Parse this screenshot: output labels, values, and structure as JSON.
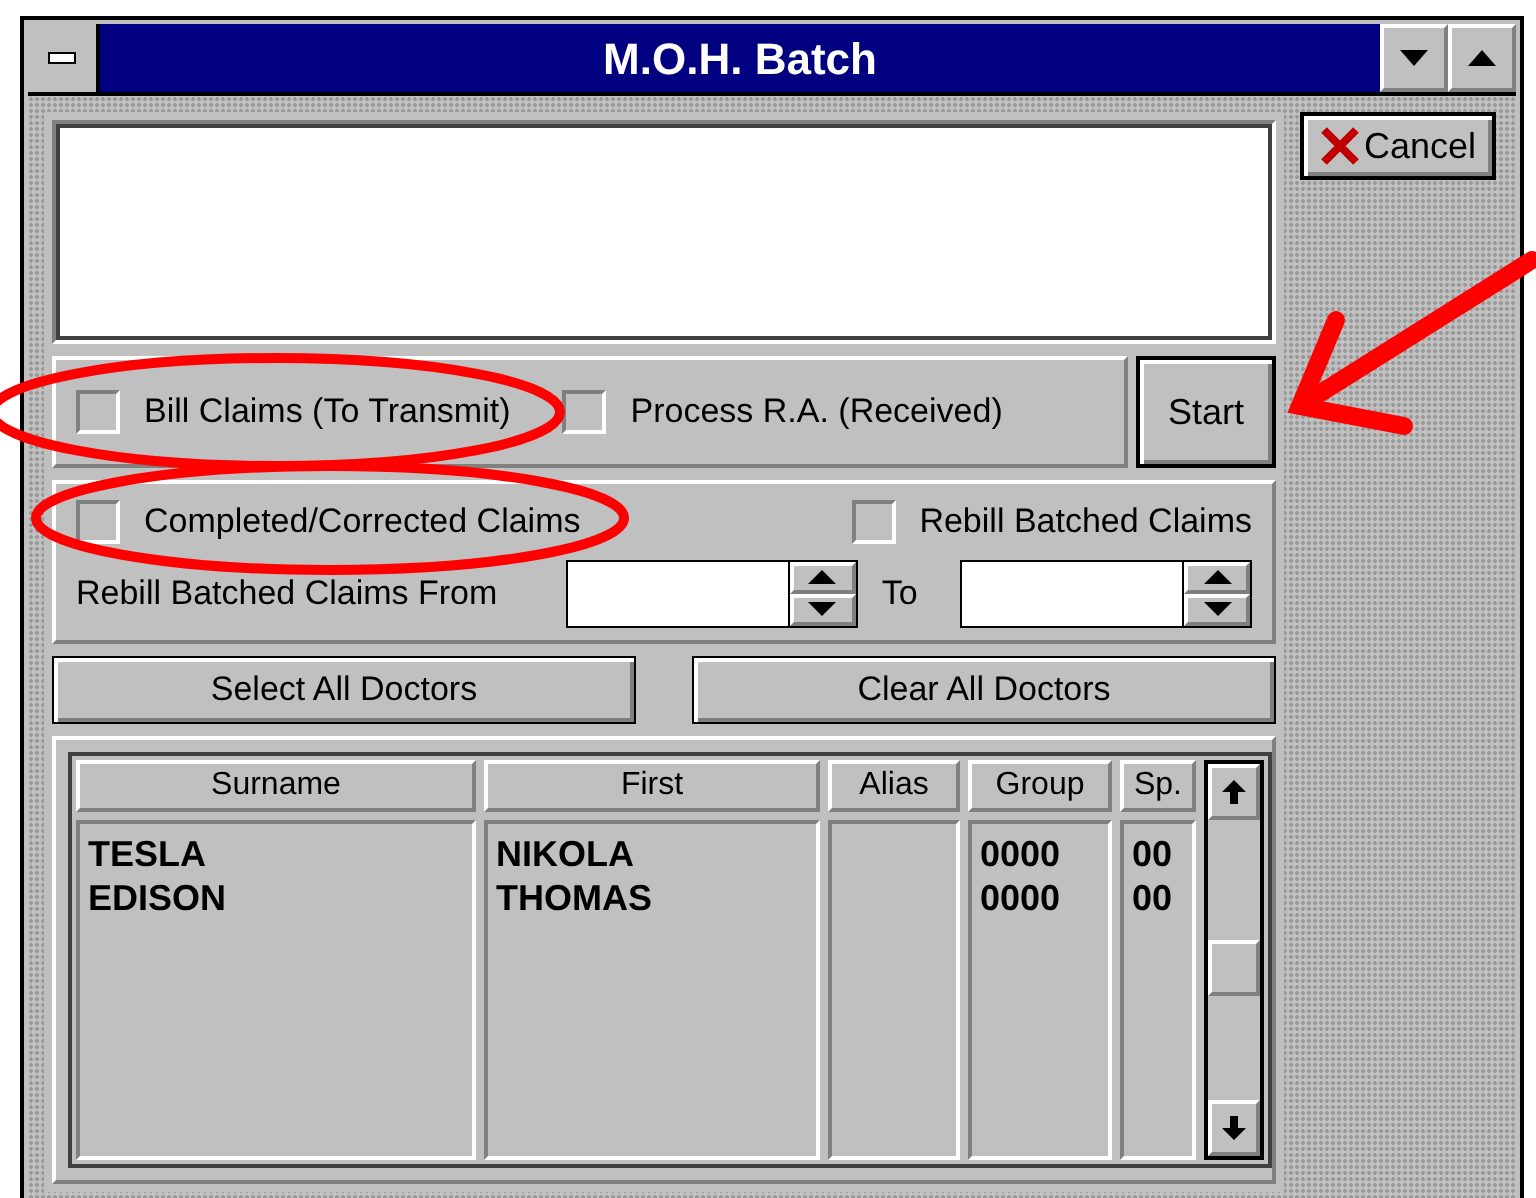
{
  "window": {
    "title": "M.O.H. Batch"
  },
  "cancel_button": {
    "label": "Cancel"
  },
  "mode_options": [
    {
      "label": "Bill Claims (To Transmit)",
      "checked": false
    },
    {
      "label": "Process R.A. (Received)",
      "checked": false
    }
  ],
  "start_button": {
    "label": "Start"
  },
  "claim_options": [
    {
      "label": "Completed/Corrected Claims",
      "checked": false
    },
    {
      "label": "Rebill Batched Claims",
      "checked": false
    }
  ],
  "rebill_range": {
    "from_label": "Rebill Batched Claims From",
    "to_label": "To"
  },
  "doctor_buttons": [
    "Select All Doctors",
    "Clear All Doctors"
  ],
  "table": {
    "columns": [
      "Surname",
      "First",
      "Alias",
      "Group",
      "Sp."
    ],
    "rows": [
      {
        "surname": "TESLA",
        "first": "NIKOLA",
        "group": "0000",
        "sp": "00"
      },
      {
        "surname": "EDISON",
        "first": "THOMAS",
        "group": "0000",
        "sp": "00"
      }
    ]
  }
}
